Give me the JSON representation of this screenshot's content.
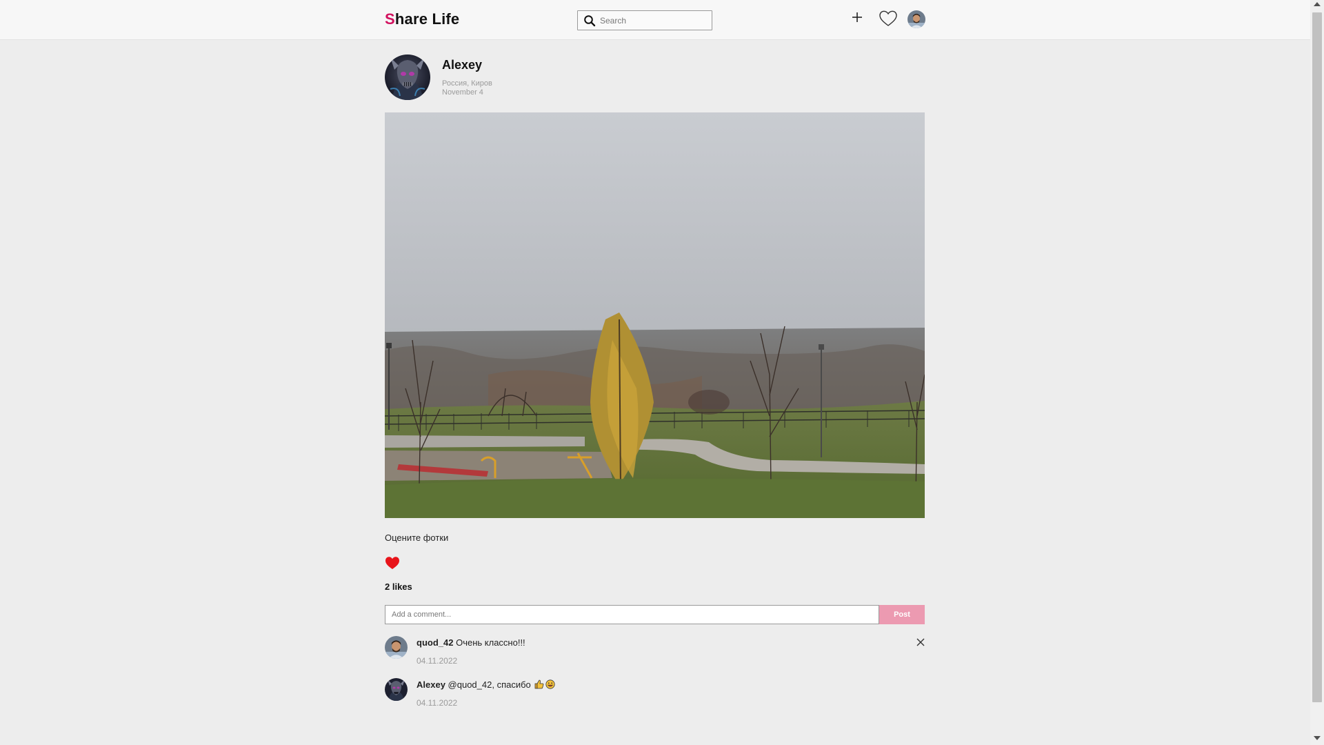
{
  "header": {
    "logo_accent": "S",
    "logo_rest": "hare Life",
    "search_placeholder": "Search"
  },
  "post": {
    "author": "Alexey",
    "location": "Россия, Киров",
    "date": "November 4",
    "caption": "Оцените фотки",
    "likes": "2 likes",
    "liked": true
  },
  "comment_box": {
    "placeholder": "Add a comment...",
    "post_label": "Post"
  },
  "comments": [
    {
      "user": "quod_42",
      "text": "Очень классно!!!",
      "date": "04.11.2022",
      "deletable": true
    },
    {
      "user": "Alexey",
      "text": "@quod_42, спасибо",
      "date": "04.11.2022",
      "deletable": false
    }
  ],
  "colors": {
    "brand_accent": "#d2125f",
    "post_button": "#ec9ab1",
    "like_heart": "#e8141a",
    "background": "#ededed"
  },
  "icons": [
    "search-icon",
    "plus-icon",
    "heart-outline-icon",
    "heart-filled-icon",
    "close-icon",
    "thumbs-up-emoji",
    "smile-emoji"
  ]
}
